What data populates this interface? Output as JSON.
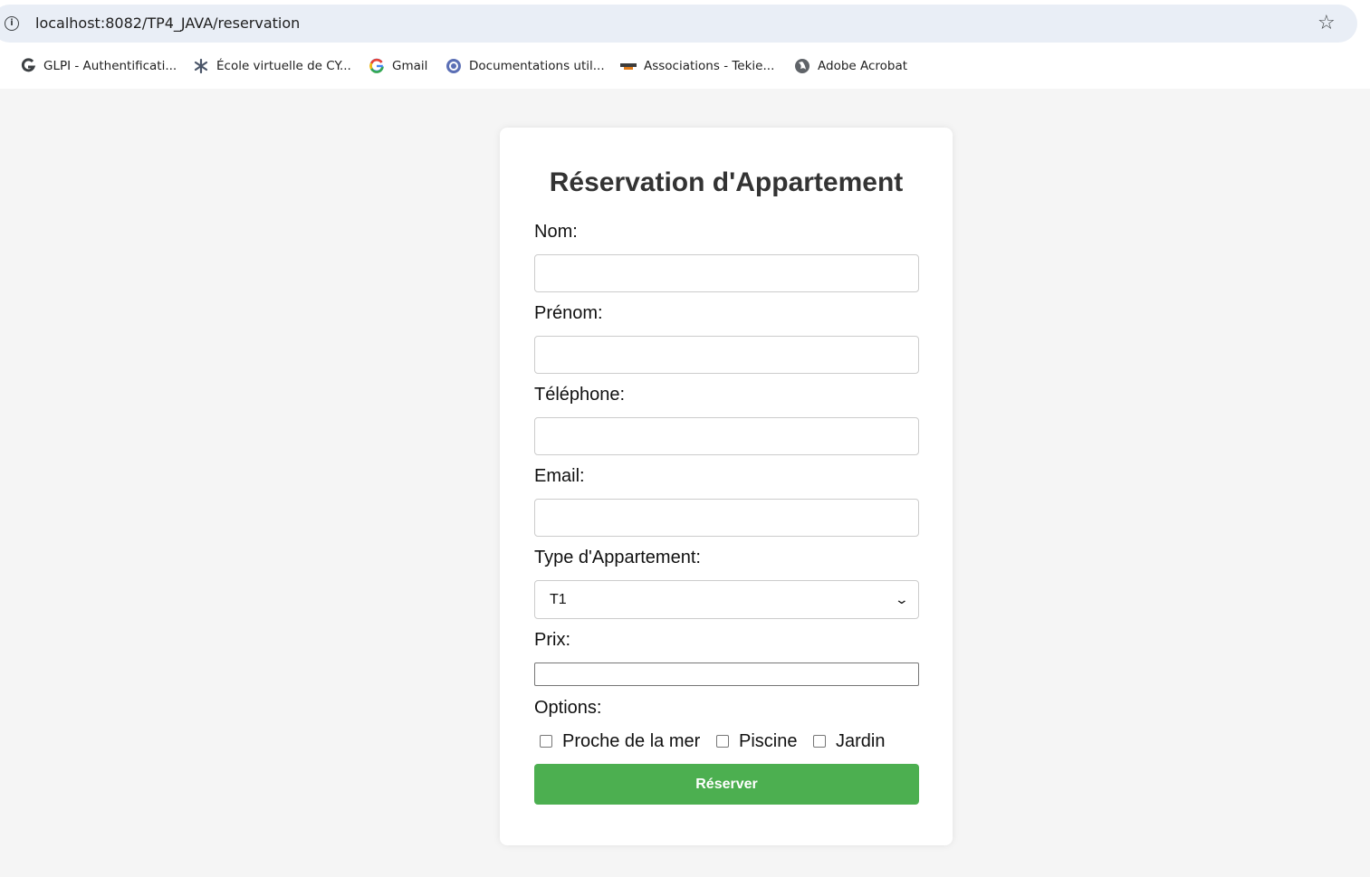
{
  "browser": {
    "url": "localhost:8082/TP4_JAVA/reservation",
    "bookmarks": [
      {
        "label": "GLPI - Authentificati...",
        "icon": "glpi-icon"
      },
      {
        "label": "École virtuelle de CY...",
        "icon": "cy-ecole-icon"
      },
      {
        "label": "Gmail",
        "icon": "google-icon"
      },
      {
        "label": "Documentations util...",
        "icon": "cy-docs-icon"
      },
      {
        "label": "Associations - Tekie...",
        "icon": "tekiens-icon"
      },
      {
        "label": "Adobe Acrobat",
        "icon": "globe-icon"
      }
    ]
  },
  "form": {
    "title": "Réservation d'Appartement",
    "fields": {
      "nom": {
        "label": "Nom:",
        "value": ""
      },
      "prenom": {
        "label": "Prénom:",
        "value": ""
      },
      "telephone": {
        "label": "Téléphone:",
        "value": ""
      },
      "email": {
        "label": "Email:",
        "value": ""
      }
    },
    "type": {
      "label": "Type d'Appartement:",
      "selected": "T1"
    },
    "prix": {
      "label": "Prix:",
      "value": ""
    },
    "options": {
      "label": "Options:",
      "items": [
        {
          "label": "Proche de la mer",
          "checked": false
        },
        {
          "label": "Piscine",
          "checked": false
        },
        {
          "label": "Jardin",
          "checked": false
        }
      ]
    },
    "submit_label": "Réserver"
  },
  "colors": {
    "submit": "#4caf50",
    "page_bg": "#f5f5f5",
    "omnibox_bg": "#e9eef6"
  }
}
